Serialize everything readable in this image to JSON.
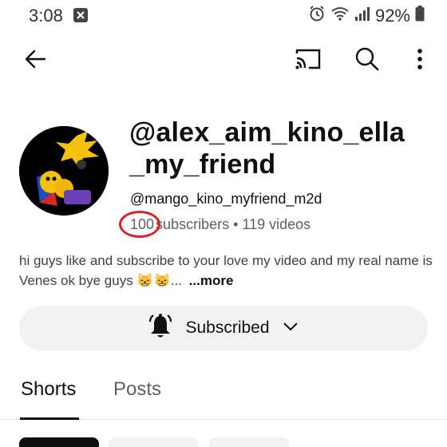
{
  "status_bar": {
    "time": "3:08",
    "battery_percent": "92%",
    "battery_level": 0.92
  },
  "icons": {
    "notification": "notification-x-icon",
    "alarm": "alarm-icon",
    "wifi": "wifi-icon",
    "signal": "signal-icon",
    "battery": "battery-icon",
    "back": "arrow-left-icon",
    "cast": "cast-icon",
    "search": "search-icon",
    "more": "more-vertical-icon",
    "bell": "bell-icon",
    "chevron": "chevron-down-icon"
  },
  "channel": {
    "name": "@alex_aim_kino_ella _my_friend",
    "handle": "@mango_kino_myfriend_m2d",
    "subscriber_count": "100",
    "subscribers_label": "subscribers",
    "separator": " • ",
    "videos": "119 videos",
    "description": "hi guys like and subscribe to your love my video and my real name is Venes ok bye guys 😸😸...",
    "more_label": "...more"
  },
  "subscribe_button": {
    "label": "Subscribed"
  },
  "tabs": [
    {
      "label": "Shorts",
      "selected": true
    },
    {
      "label": "Posts",
      "selected": false
    }
  ],
  "colors": {
    "annotation_circle": "#d8242a",
    "button_bg": "#f2f2f2",
    "text_primary": "#0f0f0f",
    "text_secondary": "#606060"
  }
}
